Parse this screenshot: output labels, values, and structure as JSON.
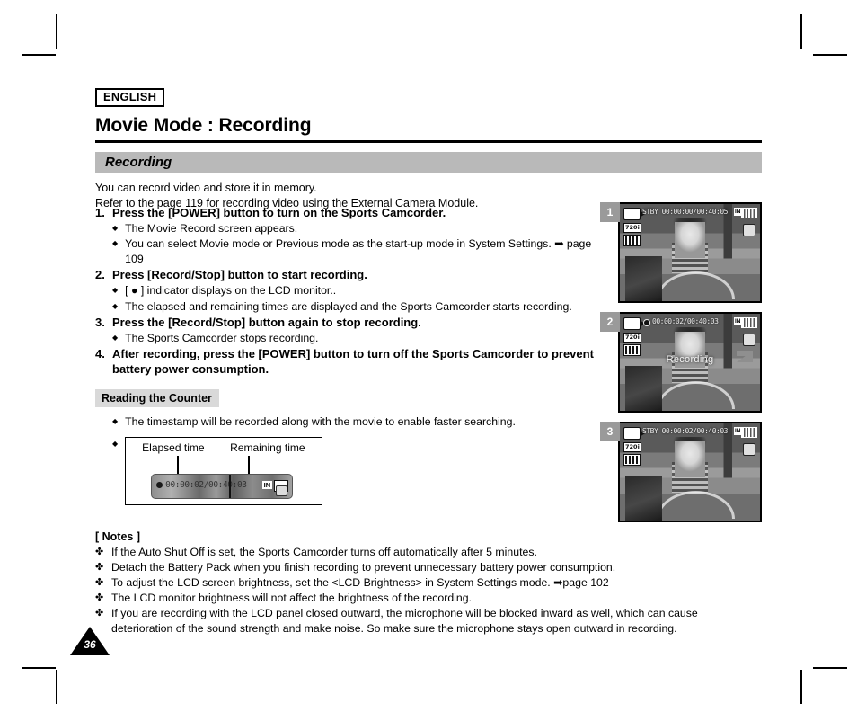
{
  "document": {
    "language_badge": "ENGLISH",
    "title": "Movie Mode : Recording",
    "page_number": "36"
  },
  "section": {
    "heading": "Recording",
    "intro_line1": "You can record video and store it in memory.",
    "intro_line2": "Refer to the page 119 for recording video using the External Camera Module."
  },
  "steps": [
    {
      "num": "1.",
      "text": "Press the [POWER] button to turn on the Sports Camcorder.",
      "bullets": [
        "The Movie Record screen appears.",
        "You can select Movie mode or Previous mode as the start-up mode in System Settings. ➡ page 109"
      ]
    },
    {
      "num": "2.",
      "text": "Press [Record/Stop] button to start recording.",
      "bullets": [
        "[ ● ] indicator displays on the LCD monitor..",
        "The elapsed and remaining times are displayed and the Sports Camcorder starts recording."
      ]
    },
    {
      "num": "3.",
      "text": "Press the [Record/Stop] button again to stop recording.",
      "bullets": [
        "The Sports Camcorder stops recording."
      ]
    },
    {
      "num": "4.",
      "text": "After recording, press the [POWER] button to turn off the Sports Camcorder to prevent battery power consumption.",
      "bullets": []
    }
  ],
  "counter": {
    "chip_label": "Reading the Counter",
    "bullet_text": "The timestamp will be recorded along with the movie to enable faster searching.",
    "caption_elapsed": "Elapsed time",
    "caption_remaining": "Remaining time",
    "timecode": "00:00:02/00:40:03",
    "memory_badge": "IN"
  },
  "notes": {
    "title": "[ Notes ]",
    "items": [
      "If the Auto Shut Off is set, the Sports Camcorder turns off automatically after 5 minutes.",
      "Detach the Battery Pack when you finish recording to prevent unnecessary battery power consumption.",
      "To adjust the LCD screen brightness, set the <LCD Brightness> in System Settings mode. ➡page 102",
      "The LCD monitor brightness will not affect the brightness of the recording.",
      "If you are recording with the LCD panel closed outward, the microphone will be blocked inward as well, which can cause deterioration of the sound strength and make noise. So make sure the microphone stays open outward in recording."
    ]
  },
  "screenshots": [
    {
      "badge": "1",
      "status": "STBY 00:00:00/00:40:05",
      "resolution": "720i",
      "memory_badge": "IN",
      "overlay_text": "",
      "recording": false
    },
    {
      "badge": "2",
      "status": "00:00:02/00:40:03",
      "resolution": "720i",
      "memory_badge": "IN",
      "overlay_text": "Recording",
      "recording": true
    },
    {
      "badge": "3",
      "status": "STBY 00:00:02/00:40:03",
      "resolution": "720i",
      "memory_badge": "IN",
      "overlay_text": "",
      "recording": false
    }
  ],
  "glyphs": {
    "diamond_bullet": "◆",
    "club_bullet": "✤"
  },
  "colors": {
    "section_bar": "#b9b9b9",
    "chip": "#d9d9d9",
    "badge": "#9a9a9a"
  }
}
